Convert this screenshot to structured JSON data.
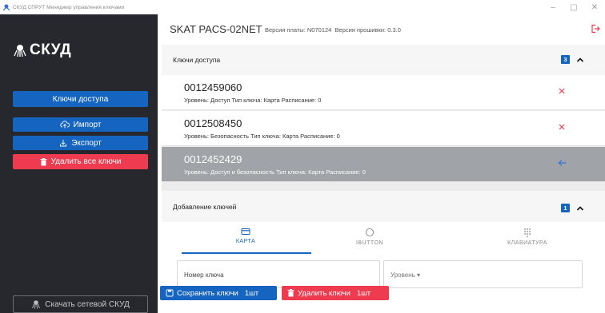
{
  "window": {
    "title": "СКУД СПРУТ Менеджер управления ключами",
    "controls": [
      "–",
      "▢",
      "✕"
    ]
  },
  "sidebar": {
    "brand": "СКУД",
    "keys_button": "Ключи доступа",
    "import_button": "Импорт",
    "export_button": "Экспорт",
    "delete_all_button": "Удалить все ключи",
    "download_button": "Скачать сетевой СКУД"
  },
  "header": {
    "device": "SKAT PACS-02NET",
    "board_label": "Версия платы:",
    "board_version": "N070124",
    "firmware_label": "Версия прошивки:",
    "firmware_version": "0.3.0"
  },
  "keys_panel": {
    "title": "Ключи доступа",
    "count": "3",
    "items": [
      {
        "number": "0012459060",
        "info": "Уровень: Доступ  Тип ключа: Карта  Расписание: 0",
        "selected": false,
        "action_icon": "close-icon"
      },
      {
        "number": "0012508450",
        "info": "Уровень: Безопасность  Тип ключа: Карта  Расписание: 0",
        "selected": false,
        "action_icon": "close-icon"
      },
      {
        "number": "0012452429",
        "info": "Уровень: Доступ и безопасность  Тип ключа: Карта  Расписание: 0",
        "selected": true,
        "action_icon": "undo-icon"
      }
    ]
  },
  "add_panel": {
    "title": "Добавление ключей",
    "count": "1",
    "tabs": [
      {
        "label": "КАРТА",
        "icon": "card-icon",
        "active": true
      },
      {
        "label": "IBUTTON",
        "icon": "ibutton-icon",
        "active": false
      },
      {
        "label": "КЛАВИАТУРА",
        "icon": "keypad-icon",
        "active": false
      }
    ],
    "key_number_placeholder": "Номер ключа",
    "level_placeholder": "Уровень ▾"
  },
  "actions": {
    "save_label": "Сохранить ключи",
    "save_count": "1шт",
    "delete_label": "Удалить ключи",
    "delete_count": "1шт"
  },
  "colors": {
    "sidebar_bg": "#26282d",
    "primary": "#1565c0",
    "danger": "#ef3b4f",
    "selected_row": "#a0a3a7"
  }
}
